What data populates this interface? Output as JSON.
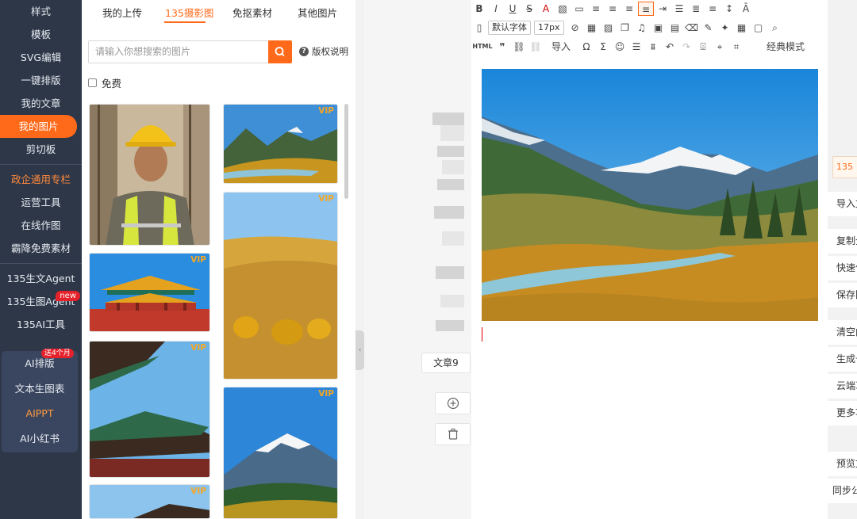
{
  "sidebar": {
    "items": [
      {
        "label": "样式"
      },
      {
        "label": "模板"
      },
      {
        "label": "SVG编辑"
      },
      {
        "label": "一键排版"
      },
      {
        "label": "我的文章"
      },
      {
        "label": "我的图片"
      },
      {
        "label": "剪切板"
      }
    ],
    "section2": [
      {
        "label": "政企通用专栏"
      },
      {
        "label": "运营工具"
      },
      {
        "label": "在线作图"
      },
      {
        "label": "霸降免费素材"
      }
    ],
    "section3": [
      {
        "label": "135生文Agent"
      },
      {
        "label": "135生图Agent",
        "badge": "new"
      },
      {
        "label": "135AI工具"
      }
    ],
    "ai_box": [
      {
        "label": "AI排版",
        "badge": "送4个月"
      },
      {
        "label": "文本生图表"
      },
      {
        "label": "AIPPT"
      },
      {
        "label": "AI小红书"
      }
    ]
  },
  "panel": {
    "tabs": [
      "我的上传",
      "135摄影图",
      "免抠素材",
      "其他图片"
    ],
    "search_placeholder": "请输入你想搜索的图片",
    "copyright": "版权说明",
    "free_label": "免费",
    "vip_label": "VIP"
  },
  "middle": {
    "article_tab": "文章9",
    "add_icon": "plus-circle-icon",
    "delete_icon": "trash-icon"
  },
  "editor": {
    "font_select": "默认字体",
    "size_select": "17px",
    "html_label": "HTML",
    "import_label": "导入",
    "mode_label": "经典模式"
  },
  "right_panel": {
    "top_label": "135",
    "items": [
      "导入文",
      "复制全",
      "快速保",
      "保存图",
      "清空内",
      "生成长",
      "云端草",
      "更多功",
      "预览文",
      "同步公"
    ]
  },
  "colors": {
    "accent": "#ff6a1a",
    "sidebar_bg": "#2d3748"
  }
}
